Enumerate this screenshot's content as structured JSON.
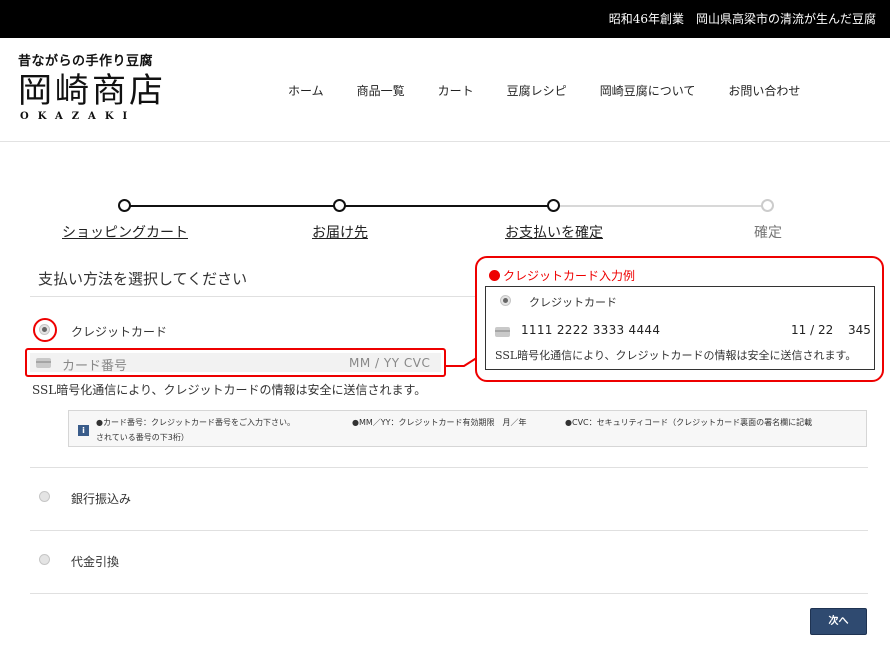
{
  "topbar": {
    "text": "昭和46年創業　岡山県高梁市の清流が生んだ豆腐"
  },
  "logo": {
    "tagline": "昔ながらの手作り豆腐",
    "name": "岡崎商店",
    "roman": "OKAZAKI"
  },
  "nav": {
    "items": [
      "ホーム",
      "商品一覧",
      "カート",
      "豆腐レシピ",
      "岡崎豆腐について",
      "お問い合わせ"
    ]
  },
  "steps": [
    {
      "label": "ショッピングカート",
      "state": "done"
    },
    {
      "label": "お届け先",
      "state": "done"
    },
    {
      "label": "お支払いを確定",
      "state": "done"
    },
    {
      "label": "確定",
      "state": "todo"
    }
  ],
  "payment": {
    "section_title": "支払い方法を選択してください",
    "options": [
      {
        "label": "クレジットカード",
        "selected": true
      },
      {
        "label": "銀行振込み",
        "selected": false
      },
      {
        "label": "代金引換",
        "selected": false
      }
    ],
    "card_number_placeholder": "カード番号",
    "expiry_cvc_placeholder": "MM / YY  CVC",
    "ssl_note": "SSL暗号化通信により、クレジットカードの情報は安全に送信されます。",
    "info": {
      "card_number": "●カード番号：クレジットカード番号をご入力下さい。",
      "mmyy": "●MM／YY：クレジットカード有効期限　月／年",
      "cvc": "●CVC：セキュリティコード（クレジットカード裏面の署名欄に記載",
      "cvc_cont": "されている番号の下3桁）"
    }
  },
  "example": {
    "title": "クレジットカード入力例",
    "option_label": "クレジットカード",
    "card_number": "1111 2222 3333 4444",
    "expiry": "11 / 22",
    "cvc": "345",
    "note": "SSL暗号化通信により、クレジットカードの情報は安全に送信されます。"
  },
  "next_button": {
    "label": "次へ"
  },
  "colors": {
    "highlight": "#e00000",
    "button": "#2f4a70",
    "topbar": "#000000"
  }
}
